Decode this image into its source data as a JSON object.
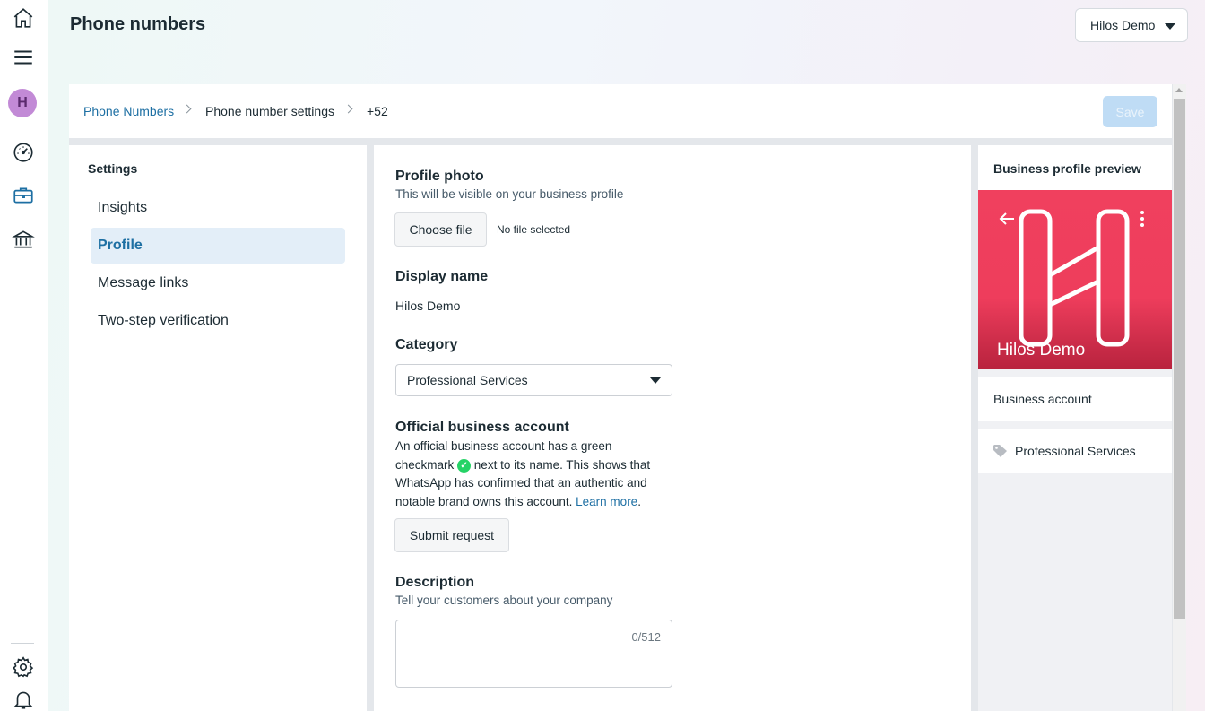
{
  "header": {
    "title": "Phone numbers",
    "account_selector": "Hilos Demo"
  },
  "rail": {
    "avatar_letter": "H",
    "icons": [
      "home-icon",
      "menu-icon",
      "dashboard-icon",
      "briefcase-icon",
      "bank-icon",
      "gear-icon",
      "bell-icon"
    ]
  },
  "breadcrumb": {
    "items": [
      "Phone Numbers",
      "Phone number settings",
      "+52"
    ]
  },
  "toolbar": {
    "save_label": "Save"
  },
  "settings": {
    "title": "Settings",
    "items": [
      {
        "label": "Insights",
        "active": false
      },
      {
        "label": "Profile",
        "active": true
      },
      {
        "label": "Message links",
        "active": false
      },
      {
        "label": "Two-step verification",
        "active": false
      }
    ]
  },
  "form": {
    "profile_photo": {
      "heading": "Profile photo",
      "subtitle": "This will be visible on your business profile",
      "button": "Choose file",
      "file_status": "No file selected"
    },
    "display_name": {
      "heading": "Display name",
      "value": "Hilos Demo"
    },
    "category": {
      "heading": "Category",
      "selected": "Professional Services"
    },
    "official": {
      "heading": "Official business account",
      "text_part1": "An official business account has a green checkmark",
      "text_part2": "next to its name. This shows that WhatsApp has confirmed that an authentic and notable brand owns this account.",
      "link": "Learn more",
      "button": "Submit request"
    },
    "description": {
      "heading": "Description",
      "subtitle": "Tell your customers about your company",
      "counter": "0/512"
    }
  },
  "preview": {
    "title": "Business profile preview",
    "name": "Hilos Demo",
    "account_type": "Business account",
    "category": "Professional Services",
    "banner_color": "#f0405e"
  },
  "colors": {
    "accent": "#1d6fa3",
    "active_bg": "#e3eef8",
    "save_disabled": "#bfdcf5",
    "verified": "#25d366"
  }
}
